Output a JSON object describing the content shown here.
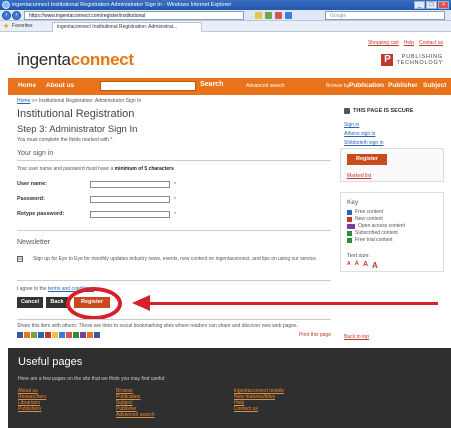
{
  "browser": {
    "title": "ingentaconnect Institutional Registration Administrator Sign In - Windows Internet Explorer",
    "url": "https://www.ingentaconnect.com/register/institutional",
    "search_placeholder": "Google",
    "favorites_label": "Favorites",
    "tab_label": "ingentaconnect Institutional Registration: Administrat..."
  },
  "header": {
    "logo_main": "ingenta",
    "logo_accent": "connect",
    "top_links": [
      "Shopping cart",
      "Help",
      "Contact us"
    ],
    "publisher_mark": "P",
    "publisher_line1": "PUBLISHING",
    "publisher_line2": "TECHNOLOGY"
  },
  "navbar": {
    "home": "Home",
    "about": "About us",
    "search_button": "Search",
    "advanced_search": "Advanced search",
    "browse_by": "Browse by:",
    "browse_items": [
      "Publication",
      "Publisher",
      "Subject"
    ]
  },
  "breadcrumb": {
    "home": "Home",
    "rest": ">> Institutional Registration: Administrator Sign In"
  },
  "main": {
    "title": "Institutional Registration",
    "step": "Step 3: Administrator Sign In",
    "required_note": "You must complete the fields marked with *",
    "signin_title": "Your sign in",
    "password_note_pre": "Your user name and password must have a",
    "password_note_bold": "minimum of 5 characters",
    "fields": {
      "username": "User name:",
      "password": "Password:",
      "retype": "Retype password:"
    },
    "required_marker": "*",
    "newsletter_title": "Newsletter",
    "newsletter_checkbox": "☑",
    "newsletter_text": "Sign up for Eye to Eye for monthly updates industry news, events, new content on ingentaconnect, and tips on using our service",
    "agree_pre": "I agree to the",
    "agree_link": "terms and conditions",
    "buttons": {
      "cancel": "Cancel",
      "back": "Back",
      "register": "Register"
    }
  },
  "share": {
    "text": "Share this item with others: These are links to social bookmarking sites where readers can share and discover new web pages.",
    "print": "Print this page",
    "back_to_top": "Back to top"
  },
  "footer": {
    "title": "Useful pages",
    "description": "Here are a few pages on the site that we think you may find useful:",
    "col1": [
      "About us",
      "Researchers",
      "Librarians",
      "Publishers"
    ],
    "col2": [
      "Browse",
      "Publication",
      "Subject",
      "Publisher",
      "Advanced search"
    ],
    "col3": [
      "ingentaconnect mobile",
      "New features/titles",
      "Help",
      "Contact us"
    ]
  },
  "sidebar": {
    "secure": "THIS PAGE IS SECURE",
    "links": [
      "Sign in",
      "Athens sign in",
      "Shibboleth sign in"
    ],
    "register": "Register",
    "marked_list": "Marked list",
    "key_title": "Key",
    "key_items": [
      {
        "label": "Free content",
        "color": "#2a64b8"
      },
      {
        "label": "New content",
        "color": "#c0392b"
      },
      {
        "label": "Open access content",
        "color": "#7b3fa0"
      },
      {
        "label": "Subscribed content",
        "color": "#2e8b3e"
      },
      {
        "label": "Free trial content",
        "color": "#2e8b3e"
      }
    ],
    "text_size_label": "Text size:",
    "text_sizes": [
      "A",
      "A",
      "A",
      "A"
    ]
  },
  "colors": {
    "accent": "#e8731a",
    "annotation": "#d6202a",
    "register": "#c94a1d"
  }
}
